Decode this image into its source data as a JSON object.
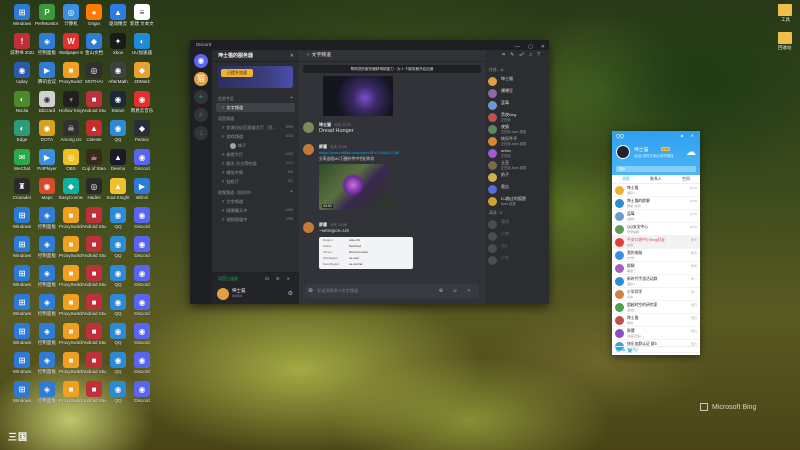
{
  "desktop": {
    "icons": [
      {
        "label": "Windows",
        "color": "#2c7ad6",
        "g": "⊞"
      },
      {
        "label": "PerfMonitor 2021",
        "color": "#3a9a3a",
        "g": "P"
      },
      {
        "label": "计算机",
        "color": "#3b8fe0",
        "g": "◎"
      },
      {
        "label": "Origin",
        "color": "#ff7a00",
        "g": "●"
      },
      {
        "label": "驱动精灵",
        "color": "#2d7be3",
        "g": "▲"
      },
      {
        "label": "新建 文本文档",
        "color": "#ffffff",
        "g": "≡"
      },
      {
        "label": "说明书 202209",
        "color": "#c0303a",
        "g": "!"
      },
      {
        "label": "控制面板",
        "color": "#2f7cd6",
        "g": "◈"
      },
      {
        "label": "Wallpaper Engine",
        "color": "#e03030",
        "g": "W"
      },
      {
        "label": "金山文档",
        "color": "#2f7cd6",
        "g": "◆"
      },
      {
        "label": "Xbox",
        "color": "#1a1a1a",
        "g": "✦"
      },
      {
        "label": "UU加速器",
        "color": "#1f8ad6",
        "g": "◐"
      },
      {
        "label": "Uplay",
        "color": "#2a5ab0",
        "g": "◉"
      },
      {
        "label": "腾讯会议",
        "color": "#2f7cd6",
        "g": "▶"
      },
      {
        "label": "ProxySwitch",
        "color": "#f0a020",
        "g": "■"
      },
      {
        "label": "MOTHAI",
        "color": "#303030",
        "g": "◎"
      },
      {
        "label": "AfterMath",
        "color": "#404040",
        "g": "◉"
      },
      {
        "label": "3DMark",
        "color": "#e8a030",
        "g": "◆"
      },
      {
        "label": "Nvidia",
        "color": "#4a8a2a",
        "g": "◐"
      },
      {
        "label": "Blizzard",
        "color": "#d0d0d0",
        "g": "◉"
      },
      {
        "label": "Hollow Knight",
        "color": "#202020",
        "g": "♆"
      },
      {
        "label": "Android Studio",
        "color": "#c0303a",
        "g": "■"
      },
      {
        "label": "Steam",
        "color": "#1b2838",
        "g": "◉"
      },
      {
        "label": "网易云音乐",
        "color": "#e03030",
        "g": "◉"
      },
      {
        "label": "Edge",
        "color": "#2d9a7a",
        "g": "◐"
      },
      {
        "label": "DOTA",
        "color": "#d8a020",
        "g": "◉"
      },
      {
        "label": "Among Us",
        "color": "#303030",
        "g": "☠"
      },
      {
        "label": "Celeste",
        "color": "#c03030",
        "g": "▲"
      },
      {
        "label": "QQ",
        "color": "#2d8ad6",
        "g": "◉"
      },
      {
        "label": "Parsec",
        "color": "#2d2d3a",
        "g": "◆"
      },
      {
        "label": "WeChat",
        "color": "#2aa84a",
        "g": "✉"
      },
      {
        "label": "PotPlayer",
        "color": "#3b8fe0",
        "g": "▶"
      },
      {
        "label": "OBS",
        "color": "#f0c020",
        "g": "◎"
      },
      {
        "label": "Cup of Steam",
        "color": "#3a2a1a",
        "g": "☕"
      },
      {
        "label": "Deemo",
        "color": "#1a1a2a",
        "g": "▲"
      },
      {
        "label": "Discord",
        "color": "#5865f2",
        "g": "◉"
      },
      {
        "label": "Crusader",
        "color": "#2a2a2a",
        "g": "♜"
      },
      {
        "label": "Maps",
        "color": "#d84a2a",
        "g": "◉"
      },
      {
        "label": "EasyConnect",
        "color": "#0fb0a0",
        "g": "◆"
      },
      {
        "label": "Hades",
        "color": "#2a2a2a",
        "g": "◎"
      },
      {
        "label": "Soul Knight",
        "color": "#f0c030",
        "g": "▲"
      },
      {
        "label": "Bilibili",
        "color": "#2d7ad6",
        "g": "▶"
      }
    ],
    "right_icons": [
      {
        "label": "工具"
      },
      {
        "label": "回收站"
      }
    ],
    "bing_label": "Microsoft Bing",
    "corner_logo": "三国"
  },
  "discord": {
    "window_title": "Discord",
    "window_buttons": [
      "—",
      "▢",
      "✕"
    ],
    "server_name": "坤士猫的服务器",
    "banner_button": "已提升加速",
    "categories": [
      "信息专区",
      "语音频道",
      "视频频道（测试中）"
    ],
    "channels": [
      {
        "name": "文字频道",
        "count": "",
        "selected": true
      },
      {
        "name": "交流讨论区频道大厅（活…",
        "count": "5/99"
      },
      {
        "name": "游戏频道",
        "count": "0/25"
      },
      {
        "name": "秘密大厅",
        "count": "0/25"
      },
      {
        "name": "聊天 方方等吃饭",
        "count": "0/12"
      },
      {
        "name": "睡觉中频",
        "count": "0/5"
      },
      {
        "name": "挂机厅",
        "count": "0/1"
      },
      {
        "name": "文字频道",
        "count": ""
      },
      {
        "name": "随便聊天中",
        "count": "0/99"
      },
      {
        "name": "视频频道中",
        "count": "0/99"
      }
    ],
    "voice_user": "坤子",
    "voice_status": "语音已连接",
    "voice_icons": "☊ ⚙ ✕",
    "user": {
      "name": "坤士猫",
      "status": "#0001",
      "gear": "⚙"
    },
    "main": {
      "channel": "文字频道",
      "notice": "帮助您的服务器获得超能力 · 为 1 个服务器开启加速",
      "messages": [
        {
          "name": "坤士猫",
          "time": "今天 12:20",
          "text": "Dread Hunger",
          "color": "#7a8a5a"
        },
        {
          "name": "胖骡",
          "time": "今天 12:26",
          "link": "https://www.bilibili.com/video/BV1Y64y1C7jM",
          "caption": "分享这段MC万圈外传中世纪的坊",
          "duration": "03:53",
          "color": "#c07a3a"
        },
        {
          "name": "胖骡",
          "time": "今天 13:05",
          "text": "~setregion=US",
          "color": "#c07a3a",
          "card": [
            [
              "Region",
              "Asia-US"
            ],
            [
              "Status",
              "Switched"
            ],
            [
              "Server",
              "discord.media"
            ],
            [
              "Old Region",
              "us-east"
            ],
            [
              "New Region",
              "us-central"
            ]
          ]
        }
      ],
      "composer_placeholder": "发送消息到 #文字频道",
      "composer_icons": "⊕ ☺ ✧"
    },
    "members_sections": [
      {
        "title": "在线 - 11",
        "members": [
          {
            "name": "坤士猫",
            "act": "",
            "color": "#e0a040"
          },
          {
            "name": "爆爆豆",
            "act": "",
            "color": "#8a6aa0"
          },
          {
            "name": "蓝莓",
            "act": "",
            "color": "#6a9ad0"
          },
          {
            "name": "黑夜king",
            "act": "正在玩",
            "color": "#c05050"
          },
          {
            "name": "夜猫",
            "act": "正在玩 Apex 英雄",
            "color": "#5a8a5a"
          },
          {
            "name": "快乐牛子",
            "act": "正在玩 Apex 英雄",
            "color": "#d08a30"
          },
          {
            "name": "anlan",
            "act": "正在玩",
            "color": "#a05ad0"
          },
          {
            "name": "土豆",
            "act": "正在玩 Apex 英雄",
            "color": "#7a6a4a"
          },
          {
            "name": "奶子",
            "act": "",
            "color": "#d0b050"
          },
          {
            "name": "奥吉",
            "act": "",
            "color": "#5a6ad0"
          },
          {
            "name": "DJ路过的狐狸",
            "act": "Apex 英雄",
            "color": "#d0a030"
          }
        ]
      },
      {
        "title": "离线 - 5",
        "members": [
          {
            "name": "离线",
            "act": "",
            "color": "#4a4c52"
          },
          {
            "name": "小李",
            "act": "",
            "color": "#4a4c52"
          },
          {
            "name": "QQ",
            "act": "",
            "color": "#4a4c52"
          },
          {
            "name": "小刘",
            "act": "",
            "color": "#4a4c52"
          }
        ]
      }
    ]
  },
  "qq": {
    "logo": "QQ",
    "window_icons": "◈ ✕",
    "nickname": "坤士猫",
    "vip": "SVIP",
    "signature": "[北京] 暂时不用QQ的时候找",
    "weather": "☁",
    "search_placeholder": "搜索",
    "tabs": [
      "消息",
      "联系人",
      "空间"
    ],
    "items": [
      {
        "name": "坤士猫",
        "msg": "[图片]",
        "time": "11:01",
        "color": "#f0b030"
      },
      {
        "name": "坤土猫的群聊",
        "msg": "胖骡: 好的",
        "time": "10:55",
        "color": "#2d8ad6"
      },
      {
        "name": "蓝莓",
        "msg": "[语音]",
        "time": "10:42",
        "color": "#6a9ad0"
      },
      {
        "name": "QQ安全中心",
        "msg": "登录提醒",
        "time": "10:20",
        "color": "#5a9a5a"
      },
      {
        "name": "平安口袋中小King好友",
        "msg": "在线",
        "time": "昨天",
        "color": "#e04040",
        "hl": true
      },
      {
        "name": "我的电脑",
        "msg": "[文件]",
        "time": "昨天",
        "color": "#3b8fe0"
      },
      {
        "name": "群聊",
        "msg": "睡觉了",
        "time": "昨天",
        "color": "#a060c0"
      },
      {
        "name": "新时代手游活动群",
        "msg": "[图片]",
        "time": "周一",
        "color": "#2d8ad6"
      },
      {
        "name": "小学同学",
        "msg": "好的",
        "time": "周一",
        "color": "#d08040"
      },
      {
        "name": "超越时空的研究家",
        "msg": "[链接]",
        "time": "周日",
        "color": "#50a050"
      },
      {
        "name": "坤土猫",
        "msg": "收到",
        "time": "周日",
        "color": "#c05050"
      },
      {
        "name": "胖骡",
        "msg": "[动画表情]",
        "time": "周六",
        "color": "#8a50c0"
      },
      {
        "name": "快乐加群认证 群5",
        "msg": "欢迎新人",
        "time": "周六",
        "color": "#3aa0e0"
      }
    ],
    "footer_icons": "☰ ✦ ▣ ☼"
  },
  "colors": {
    "discord_bg": "#313338",
    "qq_blue": "#12b7f5",
    "discord_green": "#23a559"
  }
}
